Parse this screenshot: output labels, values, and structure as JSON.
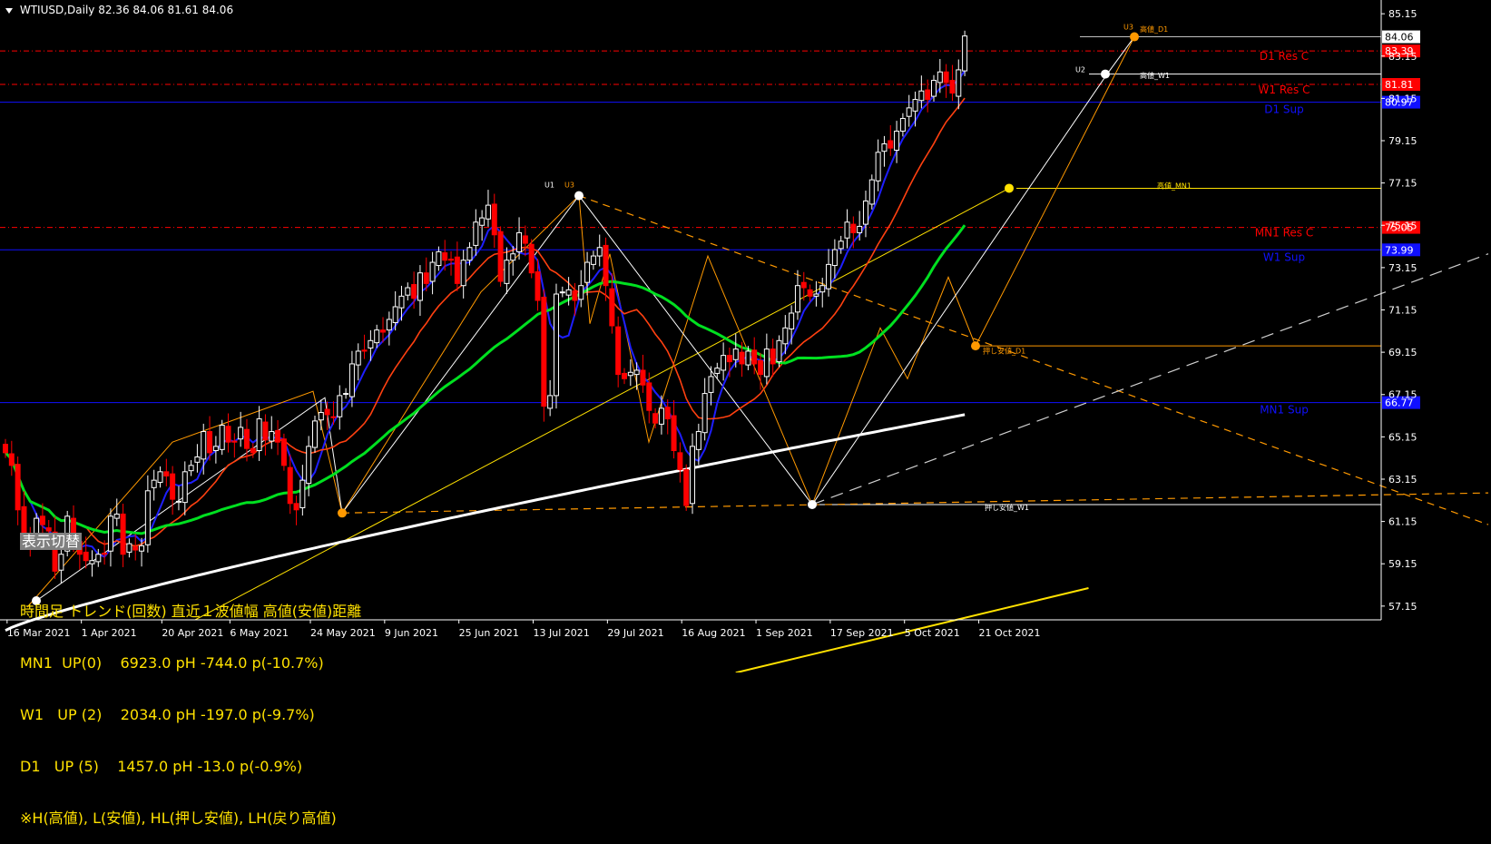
{
  "header": {
    "symbol": "WTIUSD,Daily",
    "ohlc": "82.36 84.06 81.61 84.06"
  },
  "colors": {
    "background": "#000000",
    "bull_candle": "#ffffff",
    "bear_candle": "#ff0000",
    "ma_fast": "#1e1eff",
    "ma_mid": "#ff4010",
    "ma_slow": "#00e020",
    "ma_long": "#ffffff",
    "ma_longest": "#ffe100",
    "resistance": "#ff0000",
    "support": "#1010ff",
    "fibo": "#ff9900"
  },
  "chart_data": {
    "type": "candlestick",
    "symbol": "WTIUSD",
    "timeframe": "Daily",
    "ylim": [
      56.5,
      85.8
    ],
    "y_ticks": [
      "85.15",
      "83.15",
      "81.15",
      "79.15",
      "77.15",
      "75.15",
      "73.15",
      "71.15",
      "69.15",
      "67.15",
      "65.15",
      "63.15",
      "61.15",
      "59.15",
      "57.15"
    ],
    "x_ticks": [
      "16 Mar 2021",
      "1 Apr 2021",
      "20 Apr 2021",
      "6 May 2021",
      "24 May 2021",
      "9 Jun 2021",
      "25 Jun 2021",
      "13 Jul 2021",
      "29 Jul 2021",
      "16 Aug 2021",
      "1 Sep 2021",
      "17 Sep 2021",
      "5 Oct 2021",
      "21 Oct 2021"
    ],
    "x_tick_index": [
      1,
      13,
      26,
      37,
      50,
      62,
      74,
      86,
      98,
      110,
      122,
      134,
      146,
      158
    ],
    "closes": [
      64.4,
      63.8,
      61.7,
      60.5,
      60.1,
      61.3,
      61.0,
      60.7,
      58.8,
      59.6,
      61.4,
      60.2,
      59.6,
      59.3,
      59.3,
      59.6,
      59.6,
      61.4,
      61.5,
      59.6,
      60.1,
      59.8,
      60.0,
      62.6,
      63.1,
      63.5,
      63.3,
      62.2,
      62.1,
      63.5,
      63.8,
      64.2,
      65.4,
      64.4,
      64.7,
      65.7,
      64.9,
      64.9,
      65.6,
      64.6,
      64.4,
      66.0,
      65.0,
      65.4,
      64.9,
      63.8,
      62.0,
      61.7,
      63.1,
      64.7,
      65.9,
      66.3,
      66.2,
      66.1,
      67.1,
      67.2,
      68.6,
      69.2,
      69.2,
      69.7,
      70.2,
      70.1,
      70.7,
      71.3,
      71.8,
      72.2,
      71.7,
      72.9,
      72.4,
      73.4,
      73.9,
      73.5,
      73.5,
      72.4,
      73.5,
      74.1,
      75.3,
      75.5,
      76.1,
      74.7,
      72.5,
      73.5,
      73.8,
      74.8,
      74.3,
      72.9,
      71.6,
      66.6,
      67.1,
      71.9,
      72.0,
      72.1,
      71.6,
      72.3,
      73.4,
      73.7,
      74.1,
      72.3,
      70.4,
      68.1,
      67.9,
      68.2,
      68.3,
      67.6,
      66.4,
      65.8,
      66.5,
      66.0,
      64.5,
      63.6,
      61.9,
      64.7,
      65.4,
      67.2,
      68.0,
      68.4,
      69.0,
      68.7,
      69.3,
      68.6,
      69.2,
      68.6,
      68.1,
      69.3,
      68.6,
      69.7,
      70.3,
      71.0,
      72.3,
      72.2,
      71.8,
      71.9,
      72.3,
      73.3,
      74.0,
      74.4,
      75.3,
      74.8,
      75.1,
      76.3,
      77.3,
      78.6,
      79.0,
      78.8,
      79.6,
      80.2,
      80.7,
      81.1,
      81.5,
      81.1,
      82.0,
      82.4,
      81.9,
      81.4,
      82.5,
      84.1
    ],
    "levels": [
      {
        "name": "D1 Res C",
        "value": 83.39,
        "label": "83.39",
        "kind": "resistance"
      },
      {
        "name": "W1 Res C",
        "value": 81.81,
        "label": "81.81",
        "kind": "resistance"
      },
      {
        "name": "D1 Sup",
        "value": 80.97,
        "label": "80.97",
        "kind": "support"
      },
      {
        "name": "MN1 Res C",
        "value": 75.05,
        "label": "75.05",
        "kind": "resistance"
      },
      {
        "name": "W1 Sup",
        "value": 73.99,
        "label": "73.99",
        "kind": "support"
      },
      {
        "name": "MN1 Sup",
        "value": 66.77,
        "label": "66.77",
        "kind": "support"
      }
    ],
    "current_price": "84.06",
    "marker_labels": [
      "U1",
      "U2",
      "U3",
      "高値_D1",
      "高値_W1",
      "高値_MN1",
      "押し安値_D1",
      "押し安値_W1"
    ]
  },
  "panel": {
    "toggle_label": "表示切替",
    "info_lines": [
      "時間足 トレンド(回数) 直近１波値幅 高値(安値)距離",
      "MN1  UP(0)    6923.0 pH -744.0 p(-10.7%)",
      "W1   UP (2)    2034.0 pH -197.0 p(-9.7%)",
      "D1   UP (5)    1457.0 pH -13.0 p(-0.9%)",
      "※H(高値), L(安値), HL(押し安値), LH(戻り高値)"
    ]
  }
}
